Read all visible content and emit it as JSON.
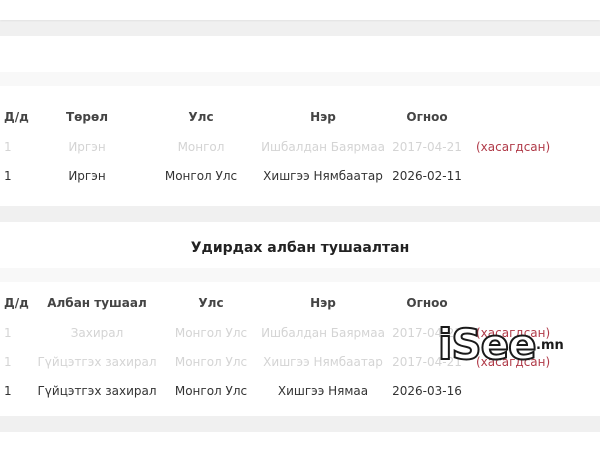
{
  "section_a": {
    "headers": [
      "Д/д",
      "Төрөл",
      "Улс",
      "Нэр",
      "Огноо",
      ""
    ],
    "rows": [
      {
        "num": "1",
        "type": "Иргэн",
        "country": "Монгол",
        "name": "Ишбалдан Баярмаа",
        "date": "2017-04-21",
        "status": "(хасагдсан)",
        "deleted": true
      },
      {
        "num": "1",
        "type": "Иргэн",
        "country": "Монгол Улс",
        "name": "Хишгээ Нямбаатар",
        "date": "2026-02-11",
        "status": "",
        "deleted": false
      }
    ]
  },
  "section_b": {
    "title": "Удирдах албан тушаалтан",
    "headers": [
      "Д/д",
      "Албан тушаал",
      "Улс",
      "Нэр",
      "Огноо",
      ""
    ],
    "rows": [
      {
        "num": "1",
        "type": "Захирал",
        "country": "Монгол Улс",
        "name": "Ишбалдан Баярмаа",
        "date": "2017-04-21",
        "status": "(хасагдсан)",
        "deleted": true
      },
      {
        "num": "1",
        "type": "Гүйцэтгэх захирал",
        "country": "Монгол Улс",
        "name": "Хишгээ Нямбаатар",
        "date": "2017-04-21",
        "status": "(хасагдсан)",
        "deleted": true
      },
      {
        "num": "1",
        "type": "Гүйцэтгэх захирал",
        "country": "Монгол Улс",
        "name": "Хишгээ Нямаа",
        "date": "2026-03-16",
        "status": "",
        "deleted": false
      }
    ]
  },
  "watermark": {
    "brand": "iSee",
    "suffix": ".mn"
  },
  "colors": {
    "status_red": "#b03a48",
    "deleted_gray": "#d4d4d4"
  }
}
